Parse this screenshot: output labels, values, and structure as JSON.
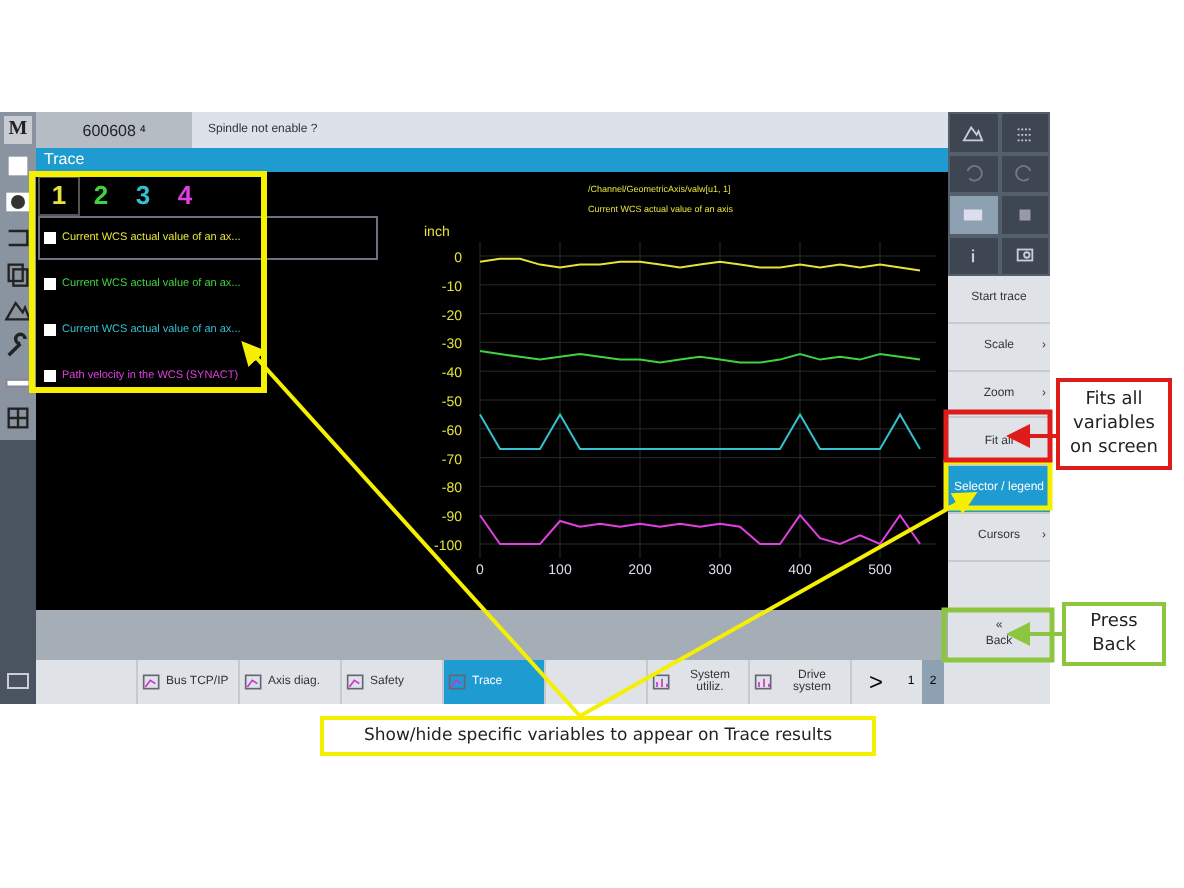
{
  "sidebar": {
    "logo": "M",
    "items": [
      {
        "kind": "doc"
      },
      {
        "kind": "disc"
      },
      {
        "kind": "bracket"
      },
      {
        "kind": "pages"
      },
      {
        "kind": "mountain"
      },
      {
        "kind": "wrench"
      },
      {
        "kind": "strip"
      },
      {
        "kind": "grid"
      }
    ]
  },
  "header": {
    "tab": "600608",
    "tab_mark": "4",
    "alarm": "Spindle not enable ?"
  },
  "panel_title": "Trace",
  "legend": {
    "tabs": [
      {
        "label": "1",
        "selected": true
      },
      {
        "label": "2",
        "selected": false
      },
      {
        "label": "3",
        "selected": false
      },
      {
        "label": "4",
        "selected": false
      }
    ],
    "variables": [
      {
        "label": "Current WCS actual value of an ax...",
        "color": "#e6e23a",
        "checked": false,
        "selected": true
      },
      {
        "label": "Current WCS actual value of an ax...",
        "color": "#3fd43f",
        "checked": false,
        "selected": false
      },
      {
        "label": "Current WCS actual value of an ax...",
        "color": "#35c0d0",
        "checked": false,
        "selected": false
      },
      {
        "label": "Path velocity in the WCS (SYNACT)",
        "color": "#e040e0",
        "checked": false,
        "selected": false
      }
    ]
  },
  "chart": {
    "variable_path": "/Channel/GeometricAxis/valw[u1, 1]",
    "variable_name": "Current WCS actual value of an axis",
    "chart_data": {
      "type": "line",
      "ylabel": "inch",
      "x": [
        0,
        25,
        50,
        75,
        100,
        125,
        150,
        175,
        200,
        225,
        250,
        275,
        300,
        325,
        350,
        375,
        400,
        425,
        450,
        475,
        500,
        525,
        550
      ],
      "series": [
        {
          "color": "#e6e23a",
          "values": [
            -2,
            -1,
            -1,
            -3,
            -4,
            -3,
            -3,
            -2,
            -2,
            -3,
            -4,
            -3,
            -2,
            -3,
            -4,
            -4,
            -3,
            -4,
            -3,
            -4,
            -3,
            -4,
            -5
          ]
        },
        {
          "color": "#3fd43f",
          "values": [
            -33,
            -34,
            -35,
            -36,
            -35,
            -34,
            -35,
            -36,
            -36,
            -37,
            -36,
            -35,
            -36,
            -37,
            -37,
            -36,
            -34,
            -36,
            -35,
            -36,
            -34,
            -35,
            -36
          ]
        },
        {
          "color": "#35c0d0",
          "values": [
            -55,
            -67,
            -67,
            -67,
            -55,
            -67,
            -67,
            -67,
            -67,
            -67,
            -67,
            -67,
            -67,
            -67,
            -67,
            -67,
            -55,
            -67,
            -67,
            -67,
            -67,
            -55,
            -67
          ]
        },
        {
          "color": "#e040e0",
          "values": [
            -90,
            -100,
            -100,
            -100,
            -92,
            -94,
            -93,
            -94,
            -93,
            -94,
            -93,
            -94,
            -93,
            -94,
            -100,
            -100,
            -90,
            -98,
            -100,
            -97,
            -100,
            -90,
            -100
          ]
        }
      ],
      "grid": true,
      "xlim": [
        0,
        570
      ],
      "ylim": [
        -105,
        5
      ],
      "xticks": [
        0,
        100,
        200,
        300,
        400,
        500
      ],
      "yticks": [
        0,
        -10,
        -20,
        -30,
        -40,
        -50,
        -60,
        -70,
        -80,
        -90,
        -100
      ]
    }
  },
  "right_panel": {
    "icons": [
      {
        "kind": "mountain"
      },
      {
        "kind": "dots"
      },
      {
        "kind": "undo"
      },
      {
        "kind": "redo"
      },
      {
        "kind": "screen"
      },
      {
        "kind": "save"
      },
      {
        "kind": "info"
      },
      {
        "kind": "camera"
      }
    ],
    "softkeys": [
      {
        "label": "Start trace",
        "selected": false
      },
      {
        "label": "Scale",
        "arrow": "›",
        "selected": false
      },
      {
        "label": "Zoom",
        "arrow": "›",
        "selected": false
      },
      {
        "label": "Fit all",
        "selected": false
      },
      {
        "label": "Selector / legend",
        "selected": true
      },
      {
        "label": "Cursors",
        "arrow": "›",
        "selected": false
      }
    ],
    "back": {
      "icon": "«",
      "label": "Back"
    }
  },
  "bottom_bar": {
    "softkeys": [
      {
        "label": "Bus TCP/IP",
        "selected": false
      },
      {
        "label": "Axis diag.",
        "selected": false
      },
      {
        "label": "Safety",
        "selected": false
      },
      {
        "label": "Trace",
        "selected": true
      },
      {
        "label": "System utiliz.",
        "selected": false
      },
      {
        "label": "Drive system",
        "selected": false
      }
    ],
    "next": ">",
    "pages": [
      {
        "label": "1",
        "selected": false
      },
      {
        "label": "2",
        "selected": true
      }
    ]
  },
  "annotations": [
    {
      "kind": "red",
      "text": "Fits all variables on screen"
    },
    {
      "kind": "green",
      "text": "Press Back"
    },
    {
      "kind": "yellow",
      "text": "Show/hide specific variables to appear on Trace results"
    }
  ]
}
